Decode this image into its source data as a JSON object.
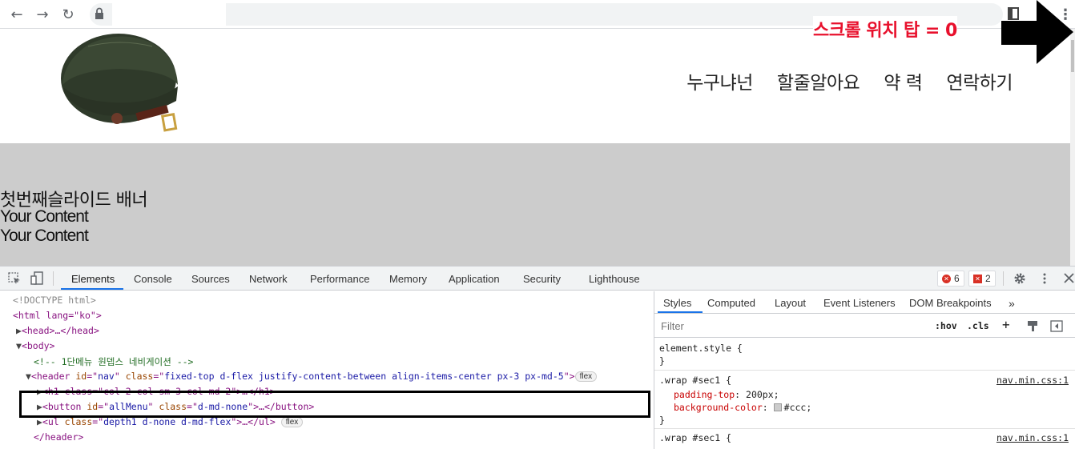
{
  "browser": {
    "back_icon": "←",
    "forward_icon": "→",
    "reload_icon": "↻",
    "menu_icon": "⋮"
  },
  "page": {
    "nav_items": [
      "누구냐넌",
      "할줄알아요",
      "약 력",
      "연락하기"
    ],
    "banner_title": "첫번째슬라이드 배너",
    "banner_lines": [
      "Your Content",
      "Your Content"
    ],
    "slider_bg": "#cccccc"
  },
  "overlay": {
    "scroll_label": "스크롤 위치 탑 = 0",
    "label_color": "#e8102c"
  },
  "devtools": {
    "tabs": [
      "Elements",
      "Console",
      "Sources",
      "Network",
      "Performance",
      "Memory",
      "Application",
      "Security",
      "Lighthouse"
    ],
    "active_tab": "Elements",
    "error_count": "6",
    "warning_count": "2",
    "elements_lines": {
      "doctype": "<!DOCTYPE html>",
      "html_open": "<html lang=\"ko\">",
      "head": "<head>…</head>",
      "body_open": "<body>",
      "comment": "<!-- 1단메뉴 원뎁스 네비게이션 -->",
      "header_tag": "header",
      "header_id_attr": "id",
      "header_id_val": "nav",
      "header_class_attr": "class",
      "header_class_val": "fixed-top d-flex justify-content-between align-items-center px-3 px-md-5",
      "h1_line": "<h1 class=\"col-2 col-sm-3 col-md-2\">…</h1>",
      "button_line_tag": "button",
      "button_id_val": "allMenu",
      "button_class_val": "d-md-none",
      "ul_class_val": "depth1 d-none d-md-flex",
      "header_close": "</header>",
      "pill_label": "flex"
    },
    "styles_tabs": [
      "Styles",
      "Computed",
      "Layout",
      "Event Listeners",
      "DOM Breakpoints"
    ],
    "filter_placeholder": "Filter",
    "hov_label": ":hov",
    "cls_label": ".cls",
    "element_style": "element.style {",
    "close_brace": "}",
    "rule_selector": ".wrap #sec1 {",
    "rule_source": "nav.min.css:1",
    "rule_props": [
      {
        "name": "padding-top",
        "value": "200px;"
      },
      {
        "name": "background-color",
        "value": "#ccc;"
      }
    ]
  }
}
